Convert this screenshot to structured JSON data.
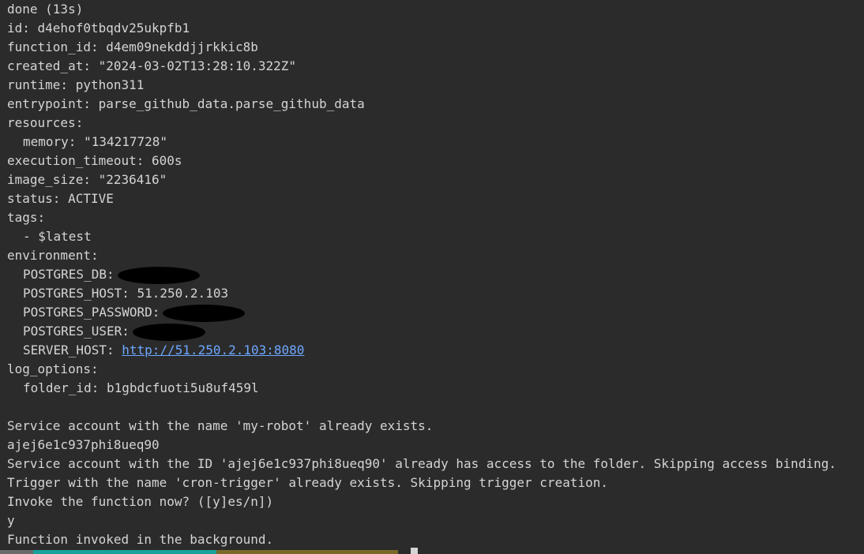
{
  "lines": {
    "status": "done (13s)",
    "id": "id: d4ehof0tbqdv25ukpfb1",
    "function_id": "function_id: d4em09nekddjjrkkic8b",
    "created_at": "created_at: \"2024-03-02T13:28:10.322Z\"",
    "runtime": "runtime: python311",
    "entrypoint": "entrypoint: parse_github_data.parse_github_data",
    "resources": "resources:",
    "memory": "memory: \"134217728\"",
    "execution_timeout": "execution_timeout: 600s",
    "image_size": "image_size: \"2236416\"",
    "status_active": "status: ACTIVE",
    "tags": "tags:",
    "tag_latest": "- $latest",
    "environment": "environment:",
    "postgres_db": "POSTGRES_DB:",
    "postgres_host": "POSTGRES_HOST: 51.250.2.103",
    "postgres_password": "POSTGRES_PASSWORD:",
    "postgres_user": "POSTGRES_USER:",
    "server_host_key": "SERVER_HOST: ",
    "server_host_url": "http://51.250.2.103:8080",
    "log_options": "log_options:",
    "folder_id": "folder_id: b1gbdcfuoti5u8uf459l",
    "blank": "",
    "sa_exists": "Service account with the name 'my-robot' already exists.",
    "sa_id": "ajej6e1c937phi8ueq90",
    "sa_access": "Service account with the ID 'ajej6e1c937phi8ueq90' already has access to the folder. Skipping access binding.",
    "trigger_exists": "Trigger with the name 'cron-trigger' already exists. Skipping trigger creation.",
    "invoke_prompt": "Invoke the function now? ([y]es/n])",
    "answer": "y",
    "invoked": "Function invoked in the background."
  },
  "colors": {
    "background": "#2b2b2b",
    "text": "#d4d4d4",
    "link": "#6ea8ff",
    "redaction": "#000000"
  }
}
